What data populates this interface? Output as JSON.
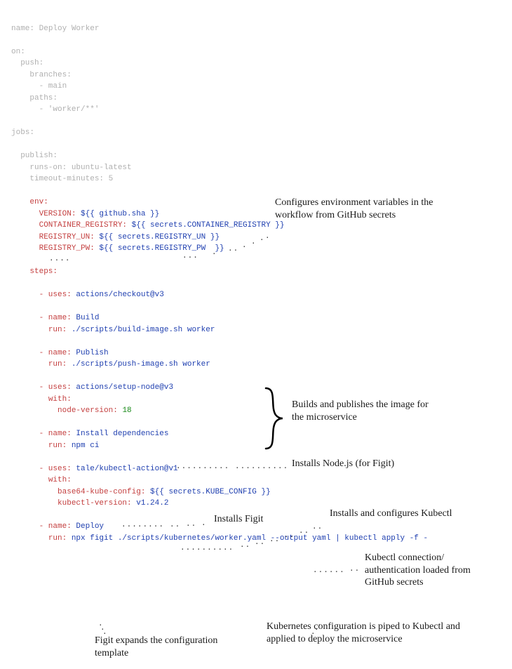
{
  "yaml": {
    "name_key": "name:",
    "name_val": " Deploy Worker",
    "on_key": "on:",
    "push_key": "push:",
    "branches_key": "branches:",
    "branches_item": "- main",
    "paths_key": "paths:",
    "paths_item": "- 'worker/**'",
    "jobs_key": "jobs:",
    "publish_key": "publish:",
    "runs_on_key": "runs-on:",
    "runs_on_val": " ubuntu-latest",
    "timeout_key": "timeout-minutes:",
    "timeout_val": " 5",
    "env_key": "env:",
    "env_version_key": "VERSION:",
    "env_version_val": " ${{ github.sha }}",
    "env_registry_key": "CONTAINER_REGISTRY:",
    "env_registry_val": " ${{ secrets.CONTAINER_REGISTRY }}",
    "env_un_key": "REGISTRY_UN:",
    "env_un_val": " ${{ secrets.REGISTRY_UN }}",
    "env_pw_key": "REGISTRY_PW:",
    "env_pw_val": " ${{ secrets.REGISTRY_PW  }}",
    "steps_key": "steps:",
    "step_checkout_uses_key": "- uses:",
    "step_checkout_uses_val": " actions/checkout@v3",
    "step_build_name_key": "- name:",
    "step_build_name_val": " Build",
    "step_build_run_key": "run:",
    "step_build_run_val": " ./scripts/build-image.sh worker",
    "step_publish_name_key": "- name:",
    "step_publish_name_val": " Publish",
    "step_publish_run_key": "run:",
    "step_publish_run_val": " ./scripts/push-image.sh worker",
    "step_node_uses_key": "- uses:",
    "step_node_uses_val": " actions/setup-node@v3",
    "step_node_with_key": "with:",
    "step_node_ver_key": "node-version:",
    "step_node_ver_val": " 18",
    "step_install_name_key": "- name:",
    "step_install_name_val": " Install dependencies",
    "step_install_run_key": "run:",
    "step_install_run_val": " npm ci",
    "step_kubectl_uses_key": "- uses:",
    "step_kubectl_uses_val": " tale/kubectl-action@v1",
    "step_kubectl_with_key": "with:",
    "step_kubectl_b64_key": "base64-kube-config:",
    "step_kubectl_b64_val": " ${{ secrets.KUBE_CONFIG }}",
    "step_kubectl_ver_key": "kubectl-version:",
    "step_kubectl_ver_val": " v1.24.2",
    "step_deploy_name_key": "- name:",
    "step_deploy_name_val": " Deploy",
    "step_deploy_run_key": "run:",
    "step_deploy_run_val": " npx figit ./scripts/kubernetes/worker.yaml --output yaml | kubectl apply -f -"
  },
  "annotations": {
    "env": "Configures environment variables in the workflow from GitHub secrets",
    "build_publish": "Builds and publishes the image for the microservice",
    "node": "Installs Node.js (for Figit)",
    "install_figit": "Installs Figit",
    "kubectl_install": "Installs and configures Kubectl",
    "kubectl_auth": "Kubectl connection/ authentication loaded from GitHub secrets",
    "figit_expand": "Figit expands the configuration template",
    "k8s_piped": "Kubernetes configuration is piped to Kubectl and applied to deploy the microservice"
  },
  "dots": {
    "d1": "....",
    "d2": "...",
    "d3": ".",
    "d4": "..",
    "d5": "..........",
    "d6": "........",
    "d7": "..",
    "d8": "..........",
    "d9": "......",
    "d10": ".........",
    "d11": "........",
    "d12": "......."
  }
}
